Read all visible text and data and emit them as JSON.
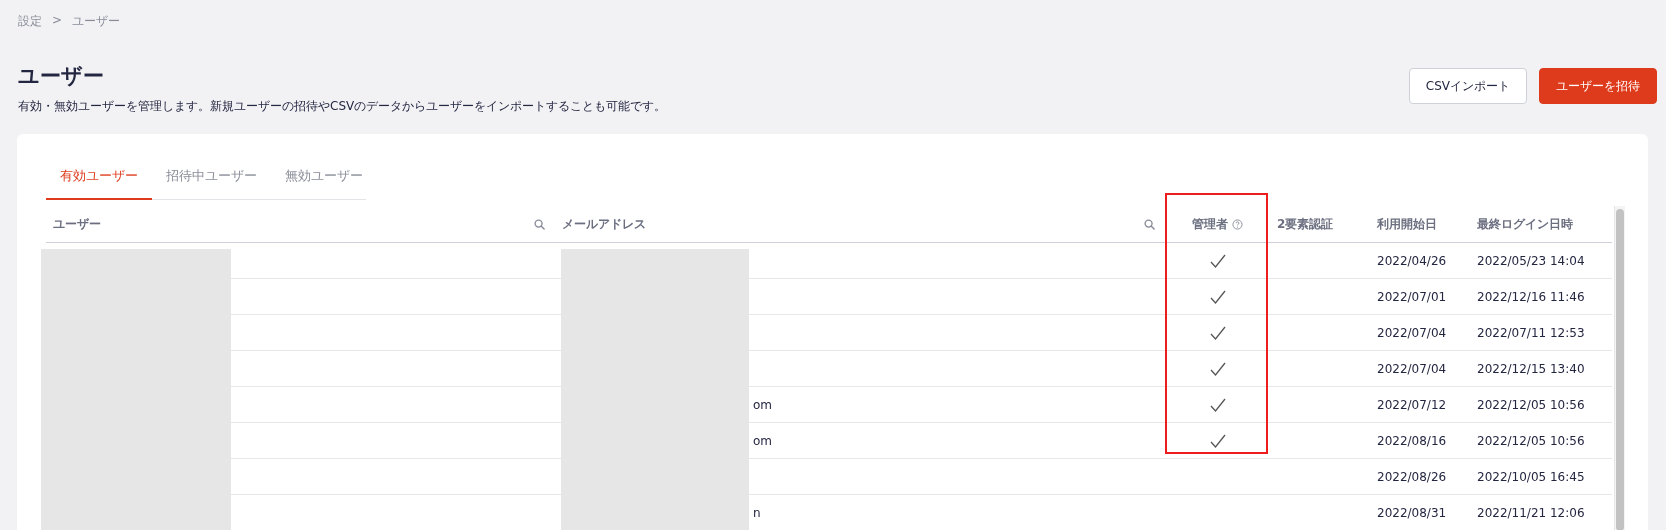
{
  "breadcrumb": [
    "設定",
    ">",
    "ユーザー"
  ],
  "title": "ユーザー",
  "description": "有効・無効ユーザーを管理します。新規ユーザーの招待やCSVのデータからユーザーをインポートすることも可能です。",
  "buttons": [
    {
      "label": "CSVインポート",
      "kind": "secondary"
    },
    {
      "label": "ユーザーを招待",
      "kind": "primary"
    }
  ],
  "tabs": [
    {
      "label": "有効ユーザー",
      "selected": true
    },
    {
      "label": "招待中ユーザー",
      "selected": false
    },
    {
      "label": "無効ユーザー",
      "selected": false
    }
  ],
  "table": {
    "columns": [
      {
        "label": "ユーザー",
        "searchable": true
      },
      {
        "label": "メールアドレス",
        "searchable": true
      },
      {
        "label": "管理者",
        "help": true
      },
      {
        "label": "2要素認証"
      },
      {
        "label": "利用開始日"
      },
      {
        "label": "最終ログイン日時"
      }
    ],
    "rows": [
      {
        "email": "",
        "admin": true,
        "start": "2022/04/26",
        "last_login": "2022/05/23 14:04"
      },
      {
        "email": "",
        "admin": true,
        "start": "2022/07/01",
        "last_login": "2022/12/16 11:46"
      },
      {
        "email": "",
        "admin": true,
        "start": "2022/07/04",
        "last_login": "2022/07/11 12:53"
      },
      {
        "email": "",
        "admin": true,
        "start": "2022/07/04",
        "last_login": "2022/12/15 13:40"
      },
      {
        "email": "om",
        "admin": true,
        "start": "2022/07/12",
        "last_login": "2022/12/05 10:56"
      },
      {
        "email": "om",
        "admin": true,
        "start": "2022/08/16",
        "last_login": "2022/12/05 10:56"
      },
      {
        "email": "",
        "admin": false,
        "start": "2022/08/26",
        "last_login": "2022/10/05 16:45"
      },
      {
        "email": "n",
        "admin": false,
        "start": "2022/08/31",
        "last_login": "2022/11/21 12:06"
      }
    ]
  }
}
